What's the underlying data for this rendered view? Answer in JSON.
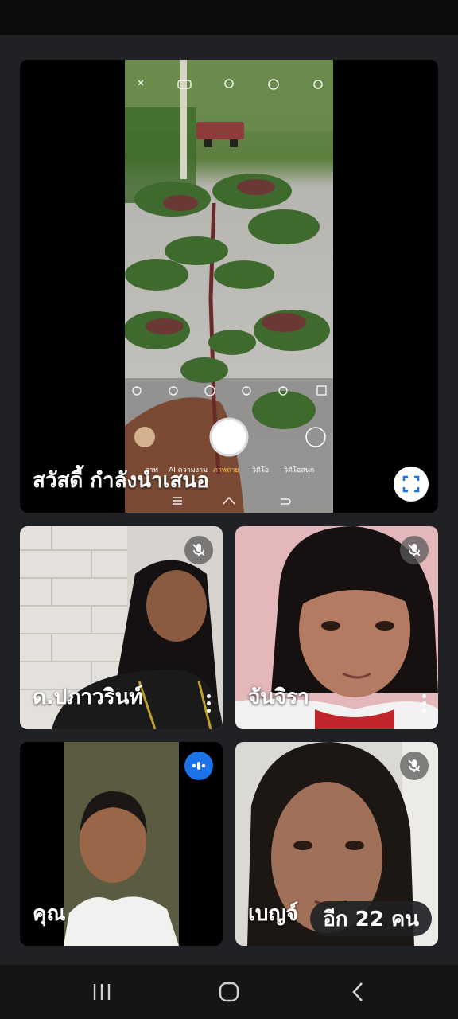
{
  "presentation": {
    "name": "สวัสดี้ กำลังนำเสนอ",
    "camera_modes": [
      "ภาพ",
      "AI ความงาม",
      "ภาพถ่าย",
      "วิดีโอ",
      "วิดีโอสนุก"
    ]
  },
  "participants": [
    {
      "name": "ด.ปภาวรินท์",
      "mic": "muted"
    },
    {
      "name": "จันจิรา",
      "mic": "muted"
    },
    {
      "name": "คุณ",
      "mic": "speaking"
    },
    {
      "name": "เบญจ์",
      "mic": "muted"
    }
  ],
  "more_participants_label": "อีก 22 คน",
  "colors": {
    "speaking_badge": "#1a73e8",
    "background": "#202124"
  },
  "icons": [
    "mic-off-icon",
    "speaking-icon",
    "more-vert-icon",
    "fullscreen-icon",
    "recents-icon",
    "home-icon",
    "back-icon"
  ]
}
